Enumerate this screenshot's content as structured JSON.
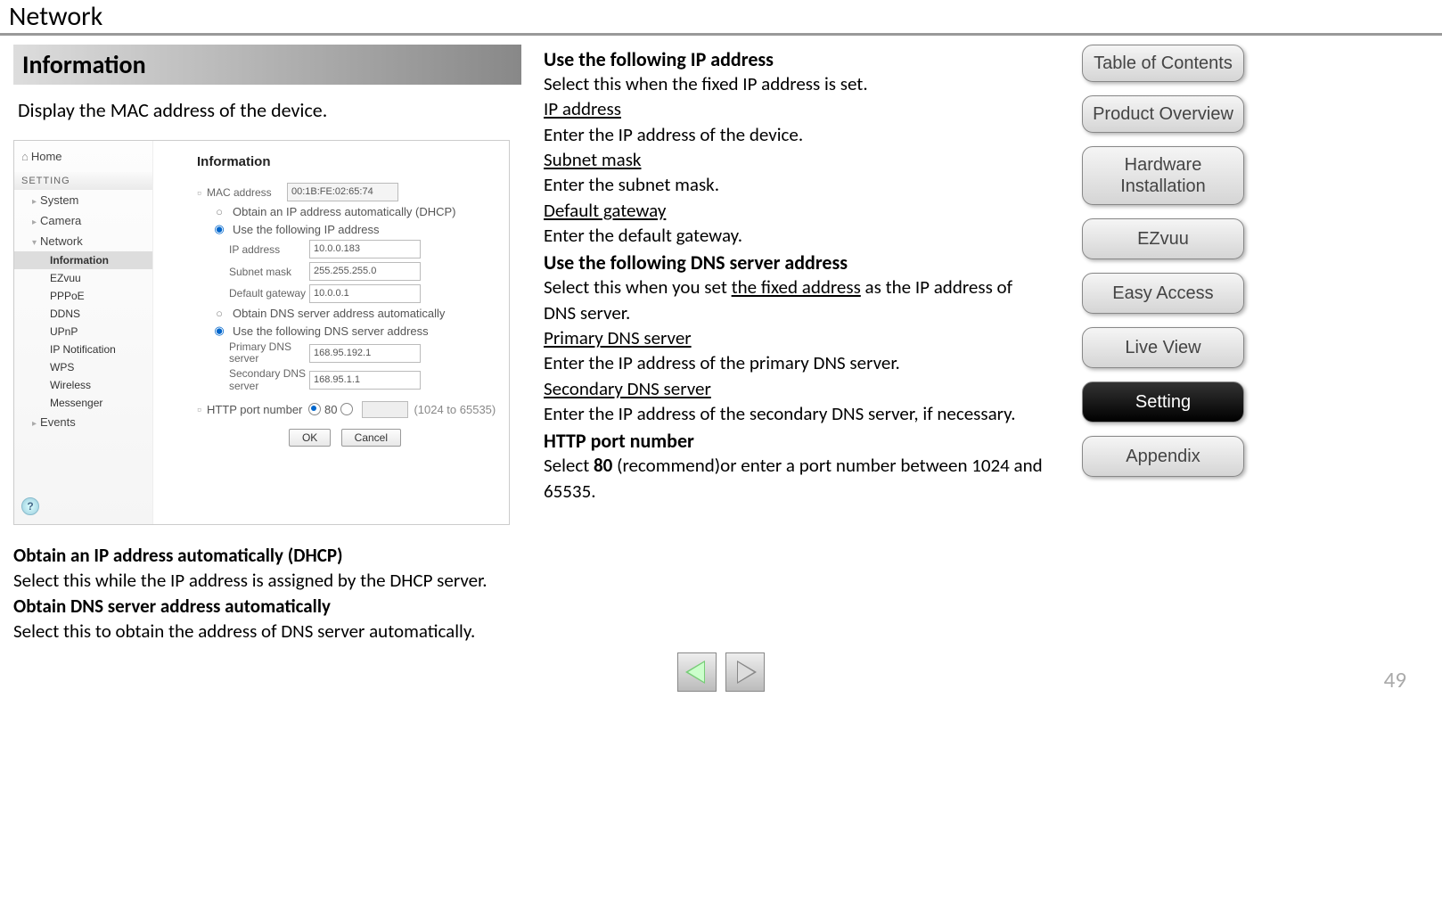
{
  "pageTitle": "Network",
  "info": {
    "header": "Information",
    "sub": "Display the MAC address of the device."
  },
  "screenshot": {
    "home": "Home",
    "sectionHead": "SETTING",
    "menu": {
      "system": "System",
      "camera": "Camera",
      "network": "Network",
      "events": "Events"
    },
    "submenu": {
      "information": "Information",
      "ezvuu": "EZvuu",
      "pppoe": "PPPoE",
      "ddns": "DDNS",
      "upnp": "UPnP",
      "ipnotif": "IP Notification",
      "wps": "WPS",
      "wireless": "Wireless",
      "messenger": "Messenger"
    },
    "mainHead": "Information",
    "fields": {
      "macLabel": "MAC address",
      "macValue": "00:1B:FE:02:65:74",
      "dhcp": "Obtain an IP address automatically (DHCP)",
      "useIp": "Use the following IP address",
      "ipLabel": "IP address",
      "ipValue": "10.0.0.183",
      "subnetLabel": "Subnet mask",
      "subnetValue": "255.255.255.0",
      "gwLabel": "Default gateway",
      "gwValue": "10.0.0.1",
      "dnsAuto": "Obtain DNS server address automatically",
      "dnsManual": "Use the following DNS server address",
      "dns1Label": "Primary DNS server",
      "dns1Value": "168.95.192.1",
      "dns2Label": "Secondary DNS server",
      "dns2Value": "168.95.1.1",
      "httpLabel": "HTTP port number",
      "httpDefault": "80",
      "httpRange": "(1024 to 65535)",
      "ok": "OK",
      "cancel": "Cancel"
    },
    "help": "?"
  },
  "leftText": {
    "h1": "Obtain an IP address automatically (DHCP)",
    "p1": "Select this while the IP address is assigned by the DHCP server.",
    "h2": "Obtain DNS server address automatically",
    "p2": "Select this to obtain the address of DNS server automatically."
  },
  "midText": {
    "h1": "Use the following IP address",
    "p1": "Select this when the fixed IP address is set.",
    "u1": "IP address",
    "p2": "Enter the IP address of the device.",
    "u2": "Subnet mask",
    "p3": "Enter the subnet mask.",
    "u3": "Default gateway",
    "p4": "Enter the default gateway.",
    "h2": "Use the following DNS server address",
    "p5a": "Select this when you set ",
    "p5u": "the fixed address",
    "p5b": " as the IP address of DNS server.",
    "u4": "Primary DNS server",
    "p6": "Enter the IP address of the primary DNS server.",
    "u5": "Secondary DNS server",
    "p7": "Enter the IP address of the secondary DNS server, if necessary.",
    "h3": "HTTP port number",
    "p8a": "Select ",
    "p8b": "80",
    "p8c": " (recommend)or enter a port number between 1024 and 65535."
  },
  "nav": {
    "toc": "Table of Contents",
    "product": "Product Overview",
    "hardware": "Hardware Installation",
    "ezvuu": "EZvuu",
    "easy": "Easy Access",
    "live": "Live View",
    "setting": "Setting",
    "appendix": "Appendix"
  },
  "pageNum": "49"
}
